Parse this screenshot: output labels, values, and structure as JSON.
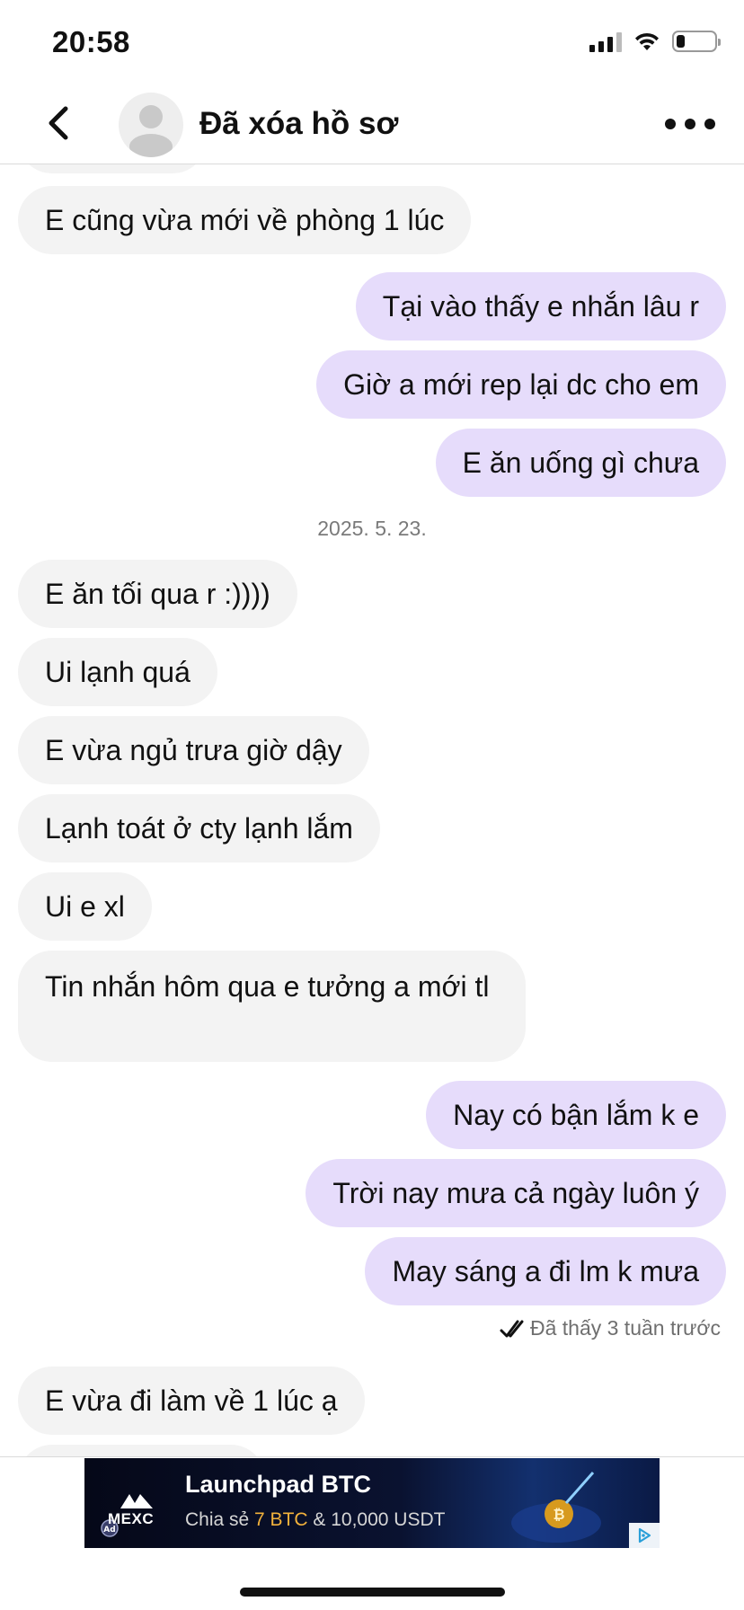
{
  "status_bar": {
    "time": "20:58"
  },
  "header": {
    "name": "Đã xóa hồ sơ"
  },
  "messages": [
    {
      "dir": "in",
      "text": "E cũng vừa mới về phòng 1 lúc"
    },
    {
      "dir": "out",
      "text": "Tại vào thấy e nhắn lâu r"
    },
    {
      "dir": "out",
      "text": "Giờ a mới rep lại dc cho em"
    },
    {
      "dir": "out",
      "text": "E ăn uống gì chưa"
    },
    {
      "dir": "in",
      "text": "E ăn tối qua r :))))"
    },
    {
      "dir": "in",
      "text": "Ui lạnh quá"
    },
    {
      "dir": "in",
      "text": "E vừa ngủ trưa giờ dậy"
    },
    {
      "dir": "in",
      "text": "Lạnh toát ở cty lạnh lắm"
    },
    {
      "dir": "in",
      "text": "Ui e xl"
    },
    {
      "dir": "in",
      "text": "Tin nhắn hôm qua e tưởng a mới tl"
    },
    {
      "dir": "out",
      "text": "Nay có bận lắm k e"
    },
    {
      "dir": "out",
      "text": "Trời nay mưa cả ngày luôn ý"
    },
    {
      "dir": "out",
      "text": "May sáng a đi lm k mưa"
    },
    {
      "dir": "in",
      "text": "E vừa đi làm về 1 lúc ạ"
    }
  ],
  "date_separator": "2025. 5. 23.",
  "seen_status": "Đã thấy 3 tuần trước",
  "ad": {
    "brand": "MEXC",
    "title": "Launchpad BTC",
    "subtitle_prefix": "Chia sẻ ",
    "subtitle_highlight": "7 BTC",
    "subtitle_suffix": " & 10,000 USDT"
  },
  "icons": {
    "back": "chevron-left-icon",
    "more": "ellipsis-icon",
    "seen": "double-check-icon",
    "avatar": "default-user-icon",
    "ad_choices": "ad-choices-icon"
  }
}
